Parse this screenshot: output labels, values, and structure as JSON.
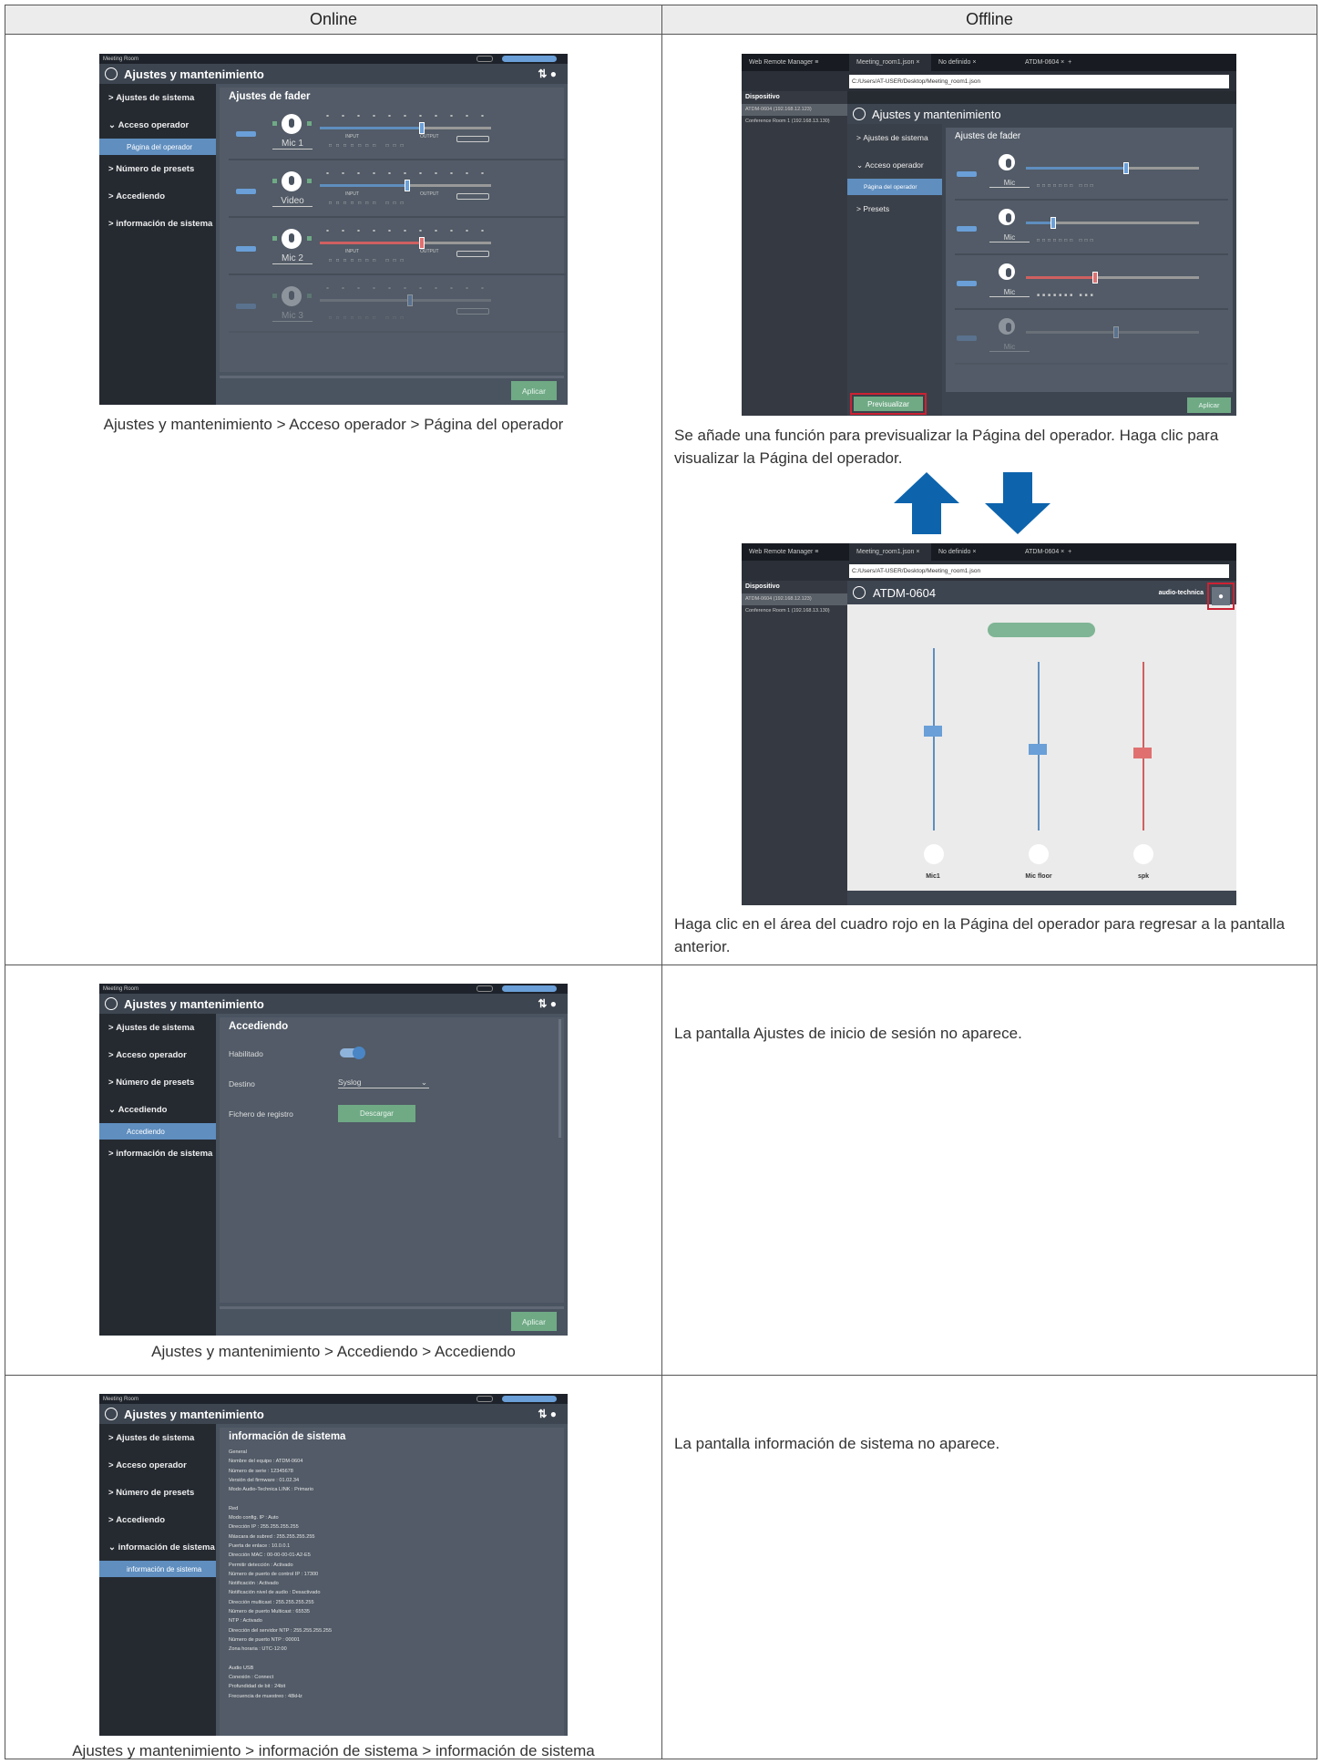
{
  "table": {
    "col_online": "Online",
    "col_offline": "Offline"
  },
  "app": {
    "topbar_name": "Meeting Room",
    "title": "Ajustes y mantenimiento",
    "apply": "Aplicar",
    "nav": {
      "sistema": "Ajustes de sistema",
      "operador": "Acceso operador",
      "pagina": "Página del operador",
      "presets": "Número de presets",
      "accediendo": "Accediendo",
      "info": "información de sistema"
    }
  },
  "row1": {
    "online": {
      "fader_title": "Ajustes de fader",
      "channels": [
        "Mic 1",
        "Video",
        "Mic 2",
        "Mic 3"
      ],
      "caption": "Ajustes y mantenimiento > Acceso operador > Página del operador"
    },
    "offline": {
      "tabs": [
        "Web Remote Manager",
        "Meeting_room1.json",
        "No definido",
        "ATDM-0604"
      ],
      "url": "C:/Users/AT-USER/Desktop/Meeting_room1.json",
      "device_header": "Dispositivo",
      "devices": [
        "ATDM-0604 (192.168.12.123)",
        "Conference Room 1 (192.168.13.130)"
      ],
      "nav_presets": "Presets",
      "channel": "Mic",
      "preview_button": "Previsualizar",
      "note1": "Se añade una función para previsualizar la Página del operador. Haga clic para visualizar la Página del operador.",
      "op_title": "ATDM-0604",
      "op_brand": "audio-technica",
      "op_channels": [
        "Mic1",
        "Mic floor",
        "spk"
      ],
      "note2": "Haga clic en el área del cuadro rojo en la Página del operador para regresar a la pantalla anterior."
    }
  },
  "row2": {
    "title": "Accediendo",
    "fields": {
      "habilitado": "Habilitado",
      "destino": "Destino",
      "destino_value": "Syslog",
      "fichero": "Fichero de registro",
      "descargar": "Descargar"
    },
    "caption": "Ajustes y mantenimiento > Accediendo > Accediendo",
    "note": "La pantalla Ajustes de inicio de sesión no aparece."
  },
  "row3": {
    "title": "información de sistema",
    "lines": [
      "General",
      "Nombre del equipo : ATDM-0604",
      "Número de serie : 12345678",
      "Versión del firmware : 01.02.34",
      "Modo Audio-Technica LINK : Primario",
      "",
      "Red",
      "Modo config. IP : Auto",
      "Dirección IP : 255.255.255.255",
      "Máscara de subred : 255.255.255.255",
      "Puerta de enlace : 10.0.0.1",
      "Dirección MAC : 00-00-00-01-A2-E5",
      "Permitir detección : Activado",
      "Número de puerto de control IP : 17300",
      "Notificación : Activado",
      "Notificación nivel de audio : Desactivado",
      "Dirección multicast : 255.255.255.255",
      "Número de puerto Multicast : 65535",
      "NTP : Activado",
      "Dirección del servidor NTP : 255.255.255.255",
      "Número de puerto NTP : 00001",
      "Zona horaria : UTC-12:00",
      "",
      "Audio USB",
      "Conexión : Connect",
      "Profundidad de bit : 24bit",
      "Frecuencia de muestreo : 48kHz"
    ],
    "caption": "Ajustes y mantenimiento > información de sistema > información de sistema",
    "note": "La pantalla información de sistema no aparece."
  }
}
